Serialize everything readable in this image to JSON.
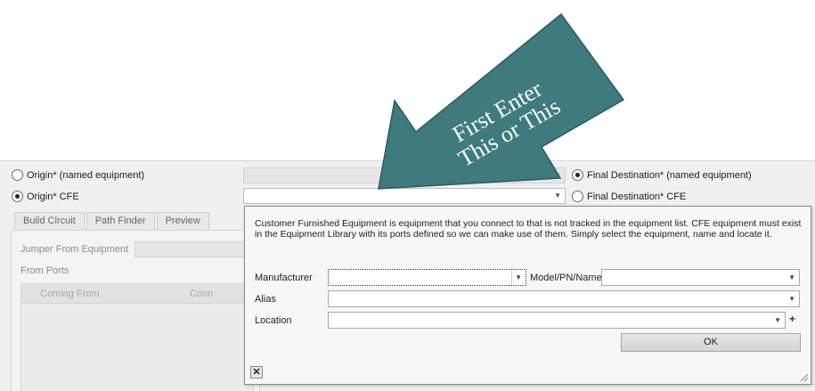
{
  "origin_named": {
    "label": "Origin* (named equipment)",
    "selected": false
  },
  "origin_cfe": {
    "label": "Origin*  CFE",
    "selected": true
  },
  "final_named": {
    "label": "Final Destination* (named equipment)",
    "selected": true
  },
  "final_cfe": {
    "label": "Final Destination* CFE",
    "selected": false
  },
  "tabs": [
    "Build Circuit",
    "Path Finder",
    "Preview"
  ],
  "left_panel": {
    "jumper_label": "Jumper From Equipment",
    "from_ports_label": "From Ports",
    "grid_columns": [
      "Coming From",
      "Conn"
    ]
  },
  "popup": {
    "description": "Customer Furnished Equipment is equipment that you connect to that is not tracked in the equipment list. CFE equipment must exist in the Equipment Library with its ports defined so we can make use of them. Simply select the equipment, name and locate it.",
    "manufacturer_label": "Manufacturer",
    "model_label": "Model/PN/Name",
    "alias_label": "Alias",
    "location_label": "Location",
    "ok_label": "OK",
    "close_glyph": "✕"
  },
  "annotation": {
    "line1": "First Enter",
    "line2": "This or This",
    "color": "#3f7b7e"
  },
  "icons": {
    "arrow": "▼",
    "plus": "+",
    "close": "close-icon"
  }
}
